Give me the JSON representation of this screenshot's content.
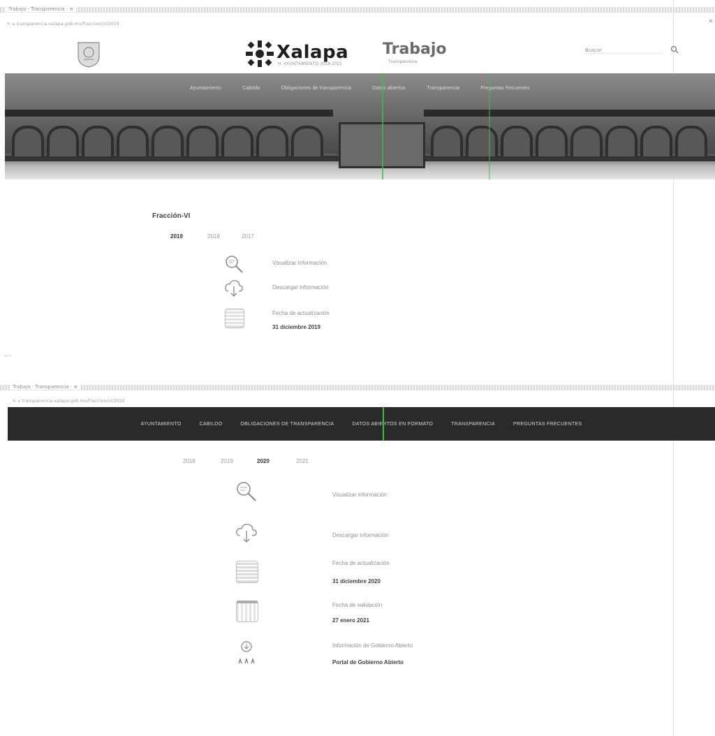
{
  "screen1": {
    "browser_tab": "Trabajo · Transparencia · ≡",
    "url": "↻  ⌂  transparencia.xalapa.gob.mx/fraccion/vi/2019",
    "header": {
      "brand": "Xalapa",
      "brand_sub": "H. AYUNTAMIENTO 2018-2021",
      "section": "Trabajo",
      "section_sub": "Transparencia",
      "search_placeholder": "Buscar"
    },
    "nav": [
      "Ayuntamiento",
      "Cabildo",
      "Obligaciones de transparencia",
      "Datos abiertos",
      "Transparencia",
      "Preguntas frecuentes"
    ],
    "page_title": "Fracción-VI",
    "years": [
      "2019",
      "2018",
      "2017"
    ],
    "active_year_index": 0,
    "items": [
      {
        "label": "Visualizar información"
      },
      {
        "label": "Descargar información"
      },
      {
        "label": "Fecha de actualización",
        "value": "31 diciembre 2019"
      }
    ]
  },
  "separator": "...",
  "screen2": {
    "browser_tab": "Trabajo · Transparencia · ≡",
    "url": "↻  ⌂  transparencia.xalapa.gob.mx/fraccion/vi/2020",
    "nav": [
      "AYUNTAMIENTO",
      "CABILDO",
      "OBLIGACIONES DE TRANSPARENCIA",
      "DATOS ABIERTOS EN FORMATO",
      "TRANSPARENCIA",
      "PREGUNTAS FRECUENTES"
    ],
    "years": [
      "2018",
      "2019",
      "2020",
      "2021"
    ],
    "active_year_index": 2,
    "items": [
      {
        "label": "Visualizar información"
      },
      {
        "label": "Descargar información"
      },
      {
        "label": "Fecha de actualización",
        "value": "31 diciembre 2020"
      },
      {
        "label": "Fecha de validación",
        "value": "27 enero 2021"
      },
      {
        "label": "Información de Gobierno Abierto",
        "value": "Portal de Gobierno Abierto"
      }
    ]
  }
}
